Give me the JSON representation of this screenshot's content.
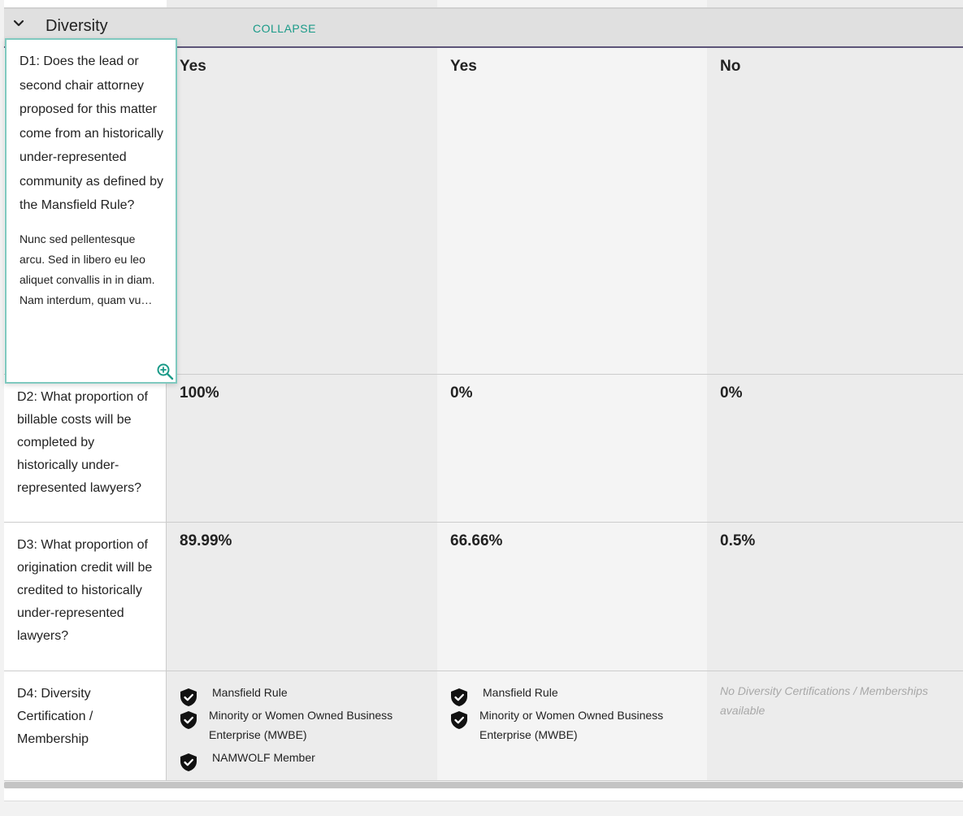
{
  "section": {
    "title": "Diversity",
    "collapse_label": "COLLAPSE"
  },
  "questions": {
    "d1": {
      "text": "D1: Does the lead or second chair attorney proposed for this matter come from an historically under-represented community as defined by the Mansfield Rule?",
      "description": "Nunc sed pellentesque arcu. Sed in libero eu leo aliquet convallis in in diam. Nam interdum, quam vu…",
      "answers": [
        "Yes",
        "Yes",
        "No"
      ]
    },
    "d2": {
      "text": "D2: What proportion of billable costs will be completed by historically under-represented lawyers?",
      "answers": [
        "100%",
        "0%",
        "0%"
      ]
    },
    "d3": {
      "text": "D3: What proportion of origination credit will be credited to historically under-represented lawyers?",
      "answers": [
        "89.99%",
        "66.66%",
        "0.5%"
      ]
    },
    "d4": {
      "text": "D4: Diversity Certification / Membership",
      "col1": [
        "Mansfield Rule",
        "Minority or Women Owned Business Enterprise (MWBE)",
        "NAMWOLF Member"
      ],
      "col2": [
        "Mansfield Rule",
        "Minority or Women Owned Business Enterprise (MWBE)"
      ],
      "col3_empty": "No Diversity Certifications / Memberships available"
    }
  },
  "icons": {
    "chevron": "chevron-down-icon",
    "zoom": "zoom-in-icon",
    "badge": "shield-check-icon"
  },
  "colors": {
    "accent": "#1a9a88",
    "header_underline": "#5c5478"
  }
}
